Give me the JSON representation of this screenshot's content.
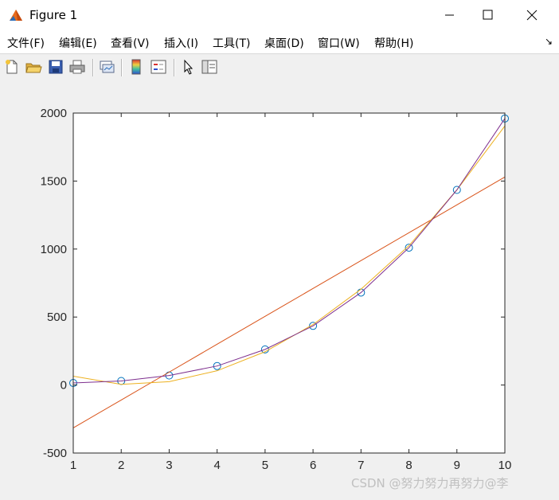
{
  "window": {
    "title": "Figure 1"
  },
  "menu": {
    "items": [
      "文件(F)",
      "编辑(E)",
      "查看(V)",
      "插入(I)",
      "工具(T)",
      "桌面(D)",
      "窗口(W)",
      "帮助(H)"
    ]
  },
  "toolbar": {
    "icons": [
      "new-figure-icon",
      "open-file-icon",
      "save-icon",
      "print-icon",
      "link-plot-icon",
      "insert-colorbar-icon",
      "insert-legend-icon",
      "edit-plot-arrow-icon",
      "plot-tools-icon"
    ]
  },
  "watermark": "CSDN @努力努力再努力@李",
  "chart_data": {
    "type": "line",
    "x": [
      1,
      2,
      3,
      4,
      5,
      6,
      7,
      8,
      9,
      10
    ],
    "xlim": [
      1,
      10
    ],
    "ylim": [
      -500,
      2000
    ],
    "xticks": [
      1,
      2,
      3,
      4,
      5,
      6,
      7,
      8,
      9,
      10
    ],
    "yticks": [
      -500,
      0,
      500,
      1000,
      1500,
      2000
    ],
    "grid": false,
    "title": "",
    "xlabel": "",
    "ylabel": "",
    "series": [
      {
        "style": "markers",
        "marker": "circle",
        "color": "#0072bd",
        "values": [
          15,
          30,
          70,
          140,
          262,
          435,
          680,
          1010,
          1435,
          1960
        ]
      },
      {
        "style": "line",
        "color": "#d95319",
        "values": [
          -315,
          -110,
          95,
          300,
          505,
          710,
          915,
          1120,
          1325,
          1530
        ]
      },
      {
        "style": "line",
        "color": "#edb120",
        "values": [
          65,
          5,
          25,
          105,
          245,
          445,
          705,
          1025,
          1435,
          1905
        ]
      },
      {
        "style": "line",
        "color": "#7e2f8e",
        "values": [
          15,
          30,
          70,
          140,
          262,
          435,
          680,
          1010,
          1435,
          1960
        ]
      }
    ]
  }
}
